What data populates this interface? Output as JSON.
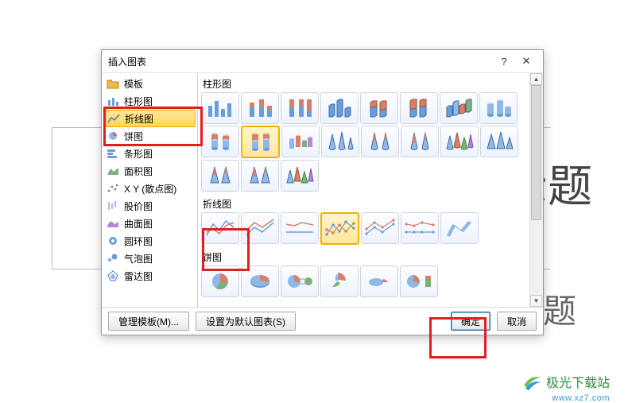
{
  "dialog": {
    "title": "插入图表",
    "help": "?",
    "close": "✕"
  },
  "categories": [
    {
      "label": "模板",
      "icon": "folder"
    },
    {
      "label": "柱形图",
      "icon": "column"
    },
    {
      "label": "折线图",
      "icon": "line",
      "selected": true
    },
    {
      "label": "饼图",
      "icon": "pie"
    },
    {
      "label": "条形图",
      "icon": "bar"
    },
    {
      "label": "面积图",
      "icon": "area"
    },
    {
      "label": "X Y (散点图)",
      "icon": "scatter"
    },
    {
      "label": "股价图",
      "icon": "stock"
    },
    {
      "label": "曲面图",
      "icon": "surface"
    },
    {
      "label": "圆环图",
      "icon": "doughnut"
    },
    {
      "label": "气泡图",
      "icon": "bubble"
    },
    {
      "label": "雷达图",
      "icon": "radar"
    }
  ],
  "sections": {
    "column": "柱形图",
    "line": "折线图",
    "pie": "饼图"
  },
  "footer": {
    "manage": "管理模板(M)...",
    "setdefault": "设置为默认图表(S)",
    "ok": "确定",
    "cancel": "取消"
  },
  "bg": {
    "title_frag": "示题",
    "sub_frag": "题"
  },
  "logo": {
    "text": "极光下载站",
    "url": "www.xz7.com"
  }
}
